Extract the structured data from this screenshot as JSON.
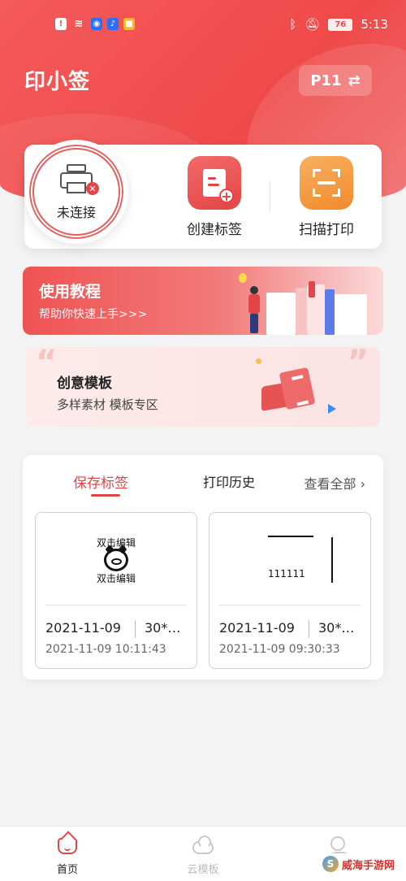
{
  "status_bar": {
    "time": "5:13",
    "battery": "76",
    "left_icons": [
      "alert-icon",
      "wifi-icon",
      "app-blue-icon",
      "app-blue2-icon",
      "app-yellow-icon"
    ],
    "right_icons": [
      "bluetooth-icon",
      "mute-icon",
      "battery-icon"
    ]
  },
  "header": {
    "app_title": "印小签",
    "printer_model": "P11",
    "switch_icon": "⇄"
  },
  "actions": {
    "connect_label": "未连接",
    "create_label": "创建标签",
    "scan_label": "扫描打印"
  },
  "tutorial": {
    "title": "使用教程",
    "subtitle": "帮助你快速上手>>>"
  },
  "creative": {
    "title": "创意模板",
    "subtitle": "多样素材 模板专区"
  },
  "labels_panel": {
    "tabs": [
      {
        "label": "保存标签",
        "active": true
      },
      {
        "label": "打印历史",
        "active": false
      }
    ],
    "view_all": "查看全部",
    "view_all_chevron": "›",
    "cards": [
      {
        "preview_top": "双击编辑",
        "preview_bottom": "双击编辑",
        "date": "2021-11-09",
        "size": "30*…",
        "timestamp": "2021-11-09 10:11:43"
      },
      {
        "preview_text": "111111",
        "date": "2021-11-09",
        "size": "30*…",
        "timestamp": "2021-11-09 09:30:33"
      }
    ]
  },
  "bottom_nav": [
    {
      "label": "首页",
      "icon": "home-icon",
      "active": true
    },
    {
      "label": "云模板",
      "icon": "cloud-icon",
      "active": false
    },
    {
      "label": "",
      "icon": "me-icon",
      "active": false
    }
  ],
  "watermark": {
    "text": "威海手游网",
    "logo": "S"
  },
  "colors": {
    "accent": "#e24545",
    "orange": "#f28a2a",
    "inactive": "#c9c9c9"
  }
}
